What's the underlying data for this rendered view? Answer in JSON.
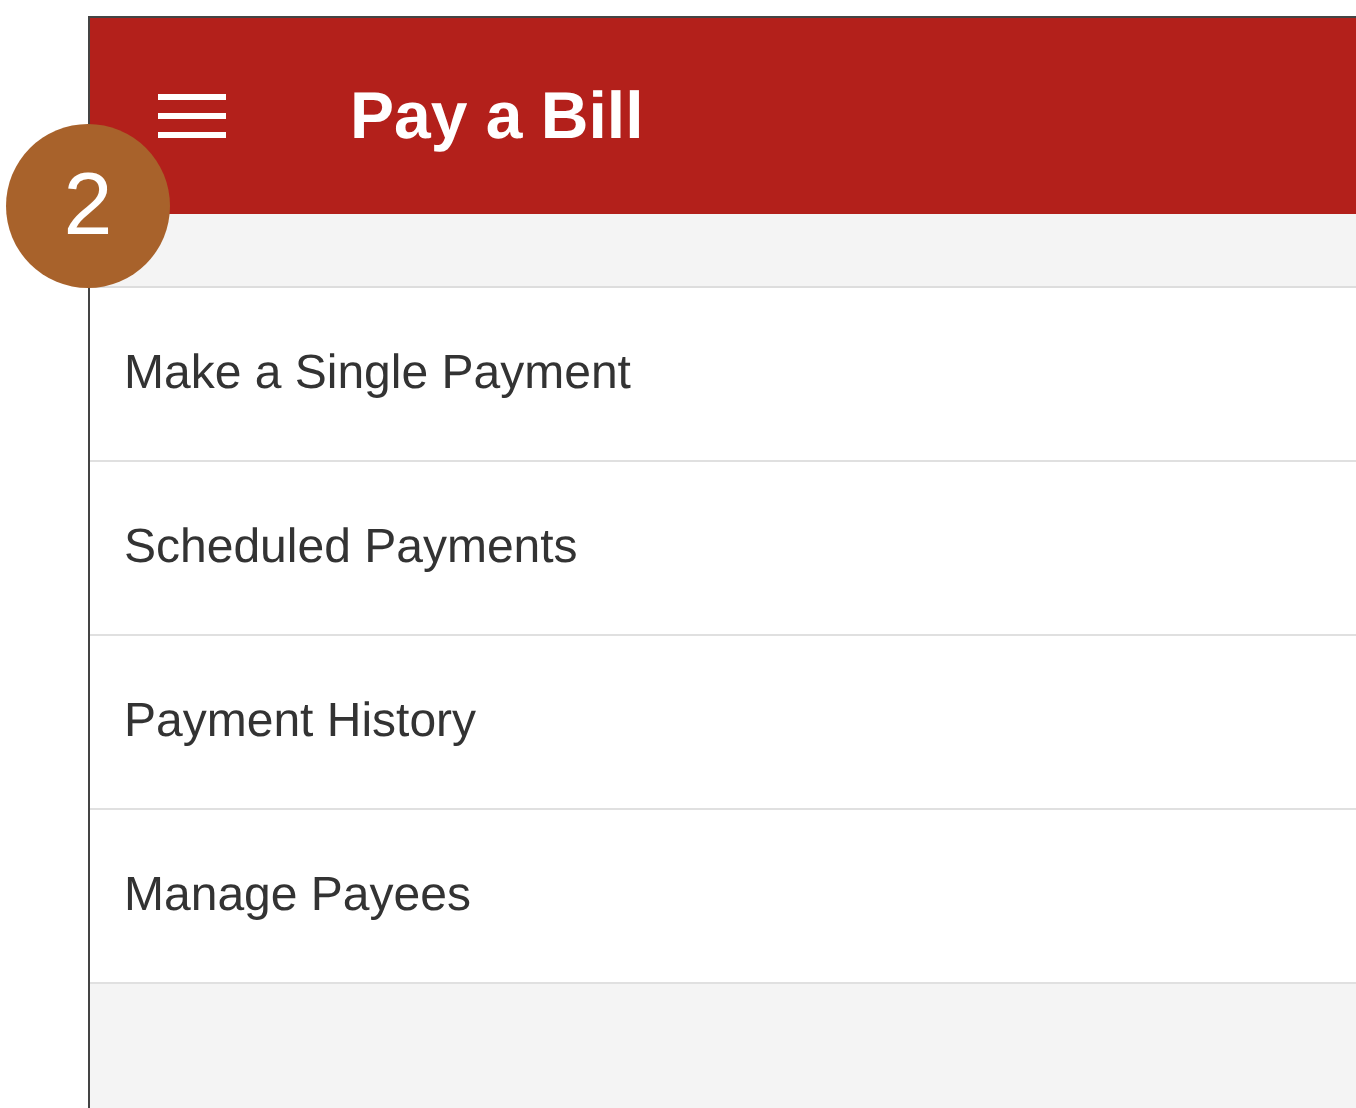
{
  "app_bar": {
    "title": "Pay a Bill"
  },
  "step_badge": "2",
  "menu_items": [
    {
      "label": "Make a Single Payment"
    },
    {
      "label": "Scheduled Payments"
    },
    {
      "label": "Payment History"
    },
    {
      "label": "Manage Payees"
    }
  ]
}
